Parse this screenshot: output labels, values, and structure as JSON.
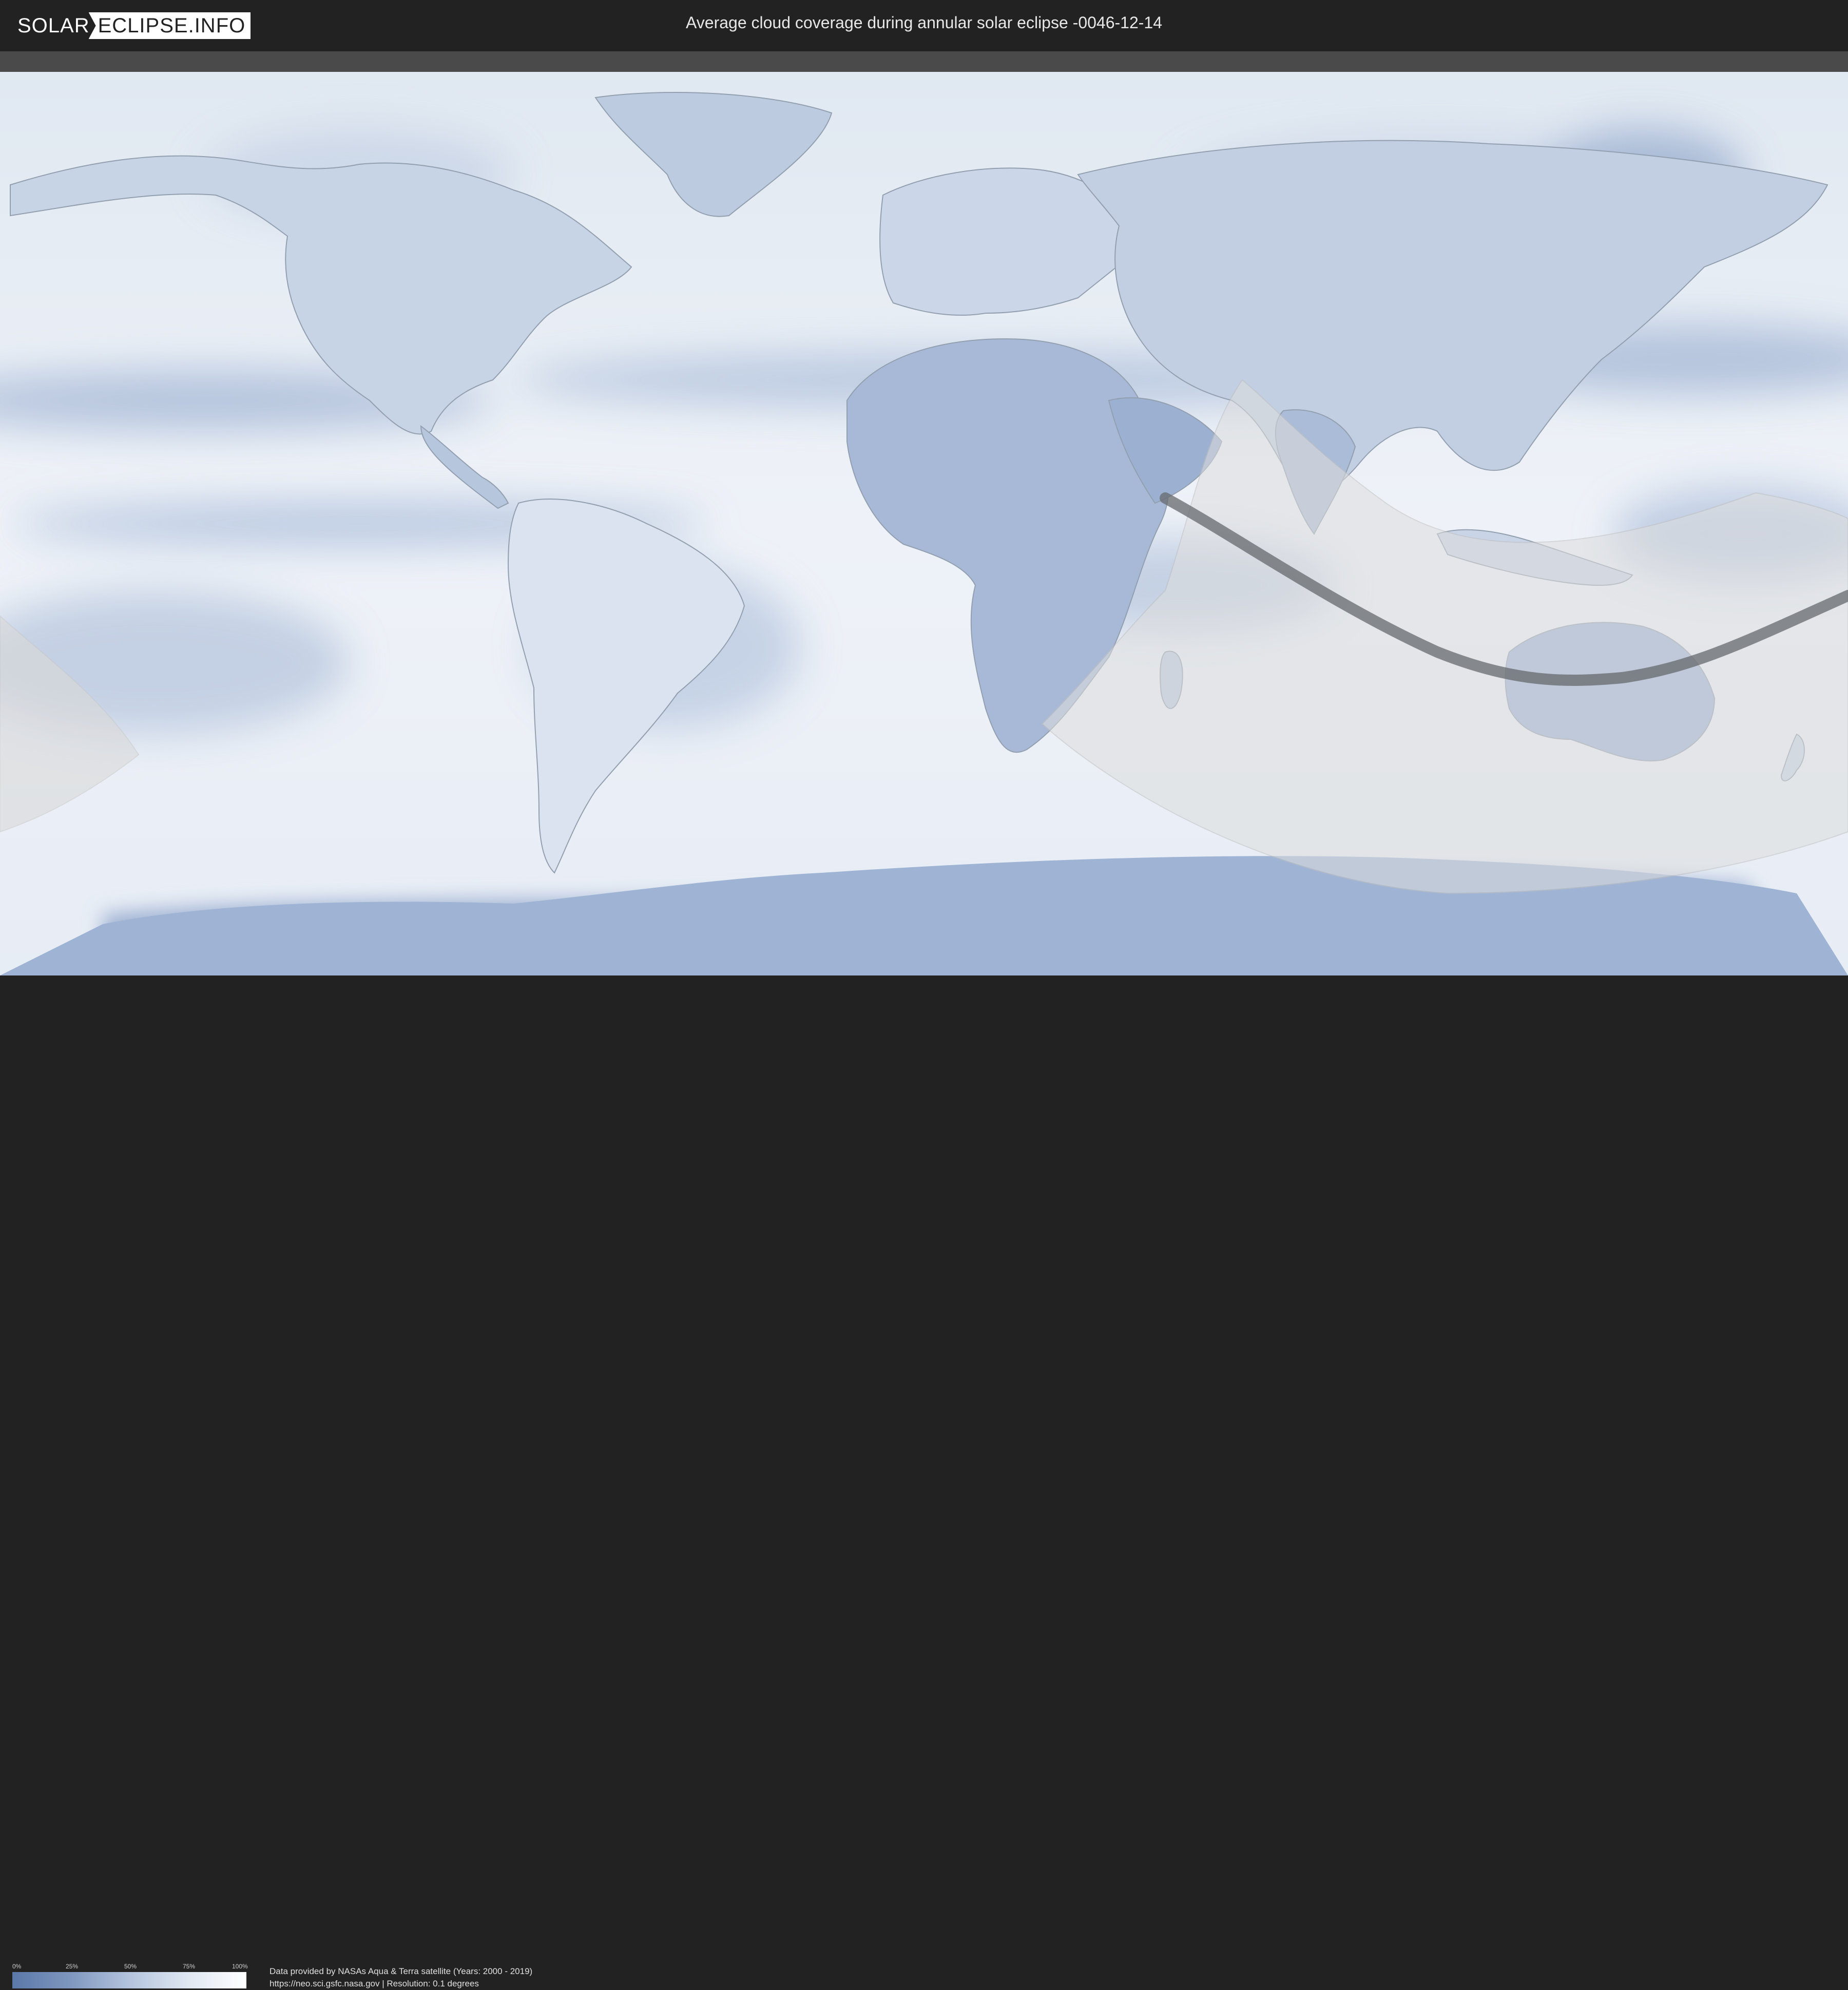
{
  "header": {
    "logo_part1": "SOLAR",
    "logo_part2": "ECLIPSE.INFO",
    "title": "Average cloud coverage during annular solar eclipse -0046-12-14"
  },
  "legend": {
    "ticks": [
      "0%",
      "25%",
      "50%",
      "75%",
      "100%"
    ],
    "colors": [
      "#5a78a8",
      "#ffffff"
    ]
  },
  "credits": {
    "line1": "Data provided by NASAs Aqua & Terra satellite (Years: 2000 - 2019)",
    "line2": "https://neo.sci.gsfc.nasa.gov | Resolution: 0.1 degrees"
  },
  "map": {
    "projection": "equirectangular",
    "cloud_low_color": "#6f8cbb",
    "cloud_high_color": "#ffffff",
    "eclipse_zone_color": "#d8d8d8",
    "path_color": "#5e6266"
  }
}
